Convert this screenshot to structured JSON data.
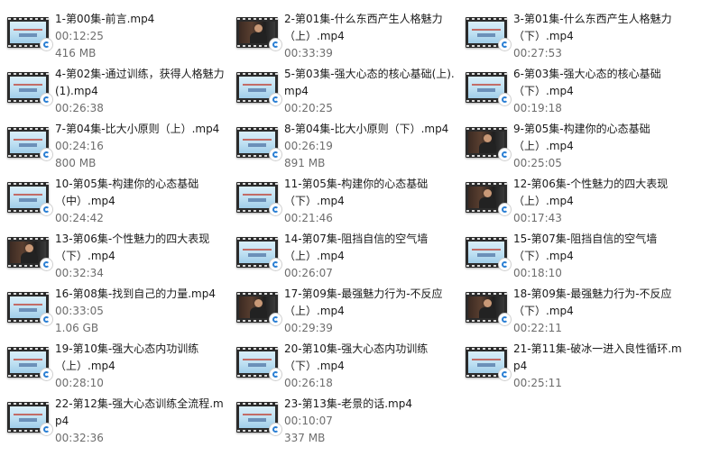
{
  "files": [
    {
      "name": "1-第00集-前言.mp4",
      "duration": "00:12:25",
      "size": "416 MB",
      "thumb": "slide"
    },
    {
      "name": "2-第01集-什么东西产生人格魅力（上）.mp4",
      "duration": "00:33:39",
      "size": "",
      "thumb": "person"
    },
    {
      "name": "3-第01集-什么东西产生人格魅力（下）.mp4",
      "duration": "00:27:53",
      "size": "",
      "thumb": "slide"
    },
    {
      "name": "4-第02集-通过训练，获得人格魅力(1).mp4",
      "duration": "00:26:38",
      "size": "",
      "thumb": "slide"
    },
    {
      "name": "5-第03集-强大心态的核心基础(上).mp4",
      "duration": "00:20:25",
      "size": "",
      "thumb": "slide"
    },
    {
      "name": "6-第03集-强大心态的核心基础（下）.mp4",
      "duration": "00:19:18",
      "size": "",
      "thumb": "slide"
    },
    {
      "name": "7-第04集-比大小原则（上）.mp4",
      "duration": "00:24:16",
      "size": "800 MB",
      "thumb": "slide"
    },
    {
      "name": "8-第04集-比大小原则（下）.mp4",
      "duration": "00:26:19",
      "size": "891 MB",
      "thumb": "slide"
    },
    {
      "name": "9-第05集-构建你的心态基础（上）.mp4",
      "duration": "00:25:05",
      "size": "",
      "thumb": "person"
    },
    {
      "name": "10-第05集-构建你的心态基础（中）.mp4",
      "duration": "00:24:42",
      "size": "",
      "thumb": "slide"
    },
    {
      "name": "11-第05集-构建你的心态基础（下）.mp4",
      "duration": "00:21:46",
      "size": "",
      "thumb": "slide"
    },
    {
      "name": "12-第06集-个性魅力的四大表现（上）.mp4",
      "duration": "00:17:43",
      "size": "",
      "thumb": "person"
    },
    {
      "name": "13-第06集-个性魅力的四大表现（下）.mp4",
      "duration": "00:32:34",
      "size": "",
      "thumb": "person"
    },
    {
      "name": "14-第07集-阻挡自信的空气墙（上）.mp4",
      "duration": "00:26:07",
      "size": "",
      "thumb": "slide"
    },
    {
      "name": "15-第07集-阻挡自信的空气墙（下）.mp4",
      "duration": "00:18:10",
      "size": "",
      "thumb": "slide"
    },
    {
      "name": "16-第08集-找到自己的力量.mp4",
      "duration": "00:33:05",
      "size": "1.06 GB",
      "thumb": "slide"
    },
    {
      "name": "17-第09集-最强魅力行为-不反应（上）.mp4",
      "duration": "00:29:39",
      "size": "",
      "thumb": "person"
    },
    {
      "name": "18-第09集-最强魅力行为-不反应（下）.mp4",
      "duration": "00:22:11",
      "size": "",
      "thumb": "person"
    },
    {
      "name": "19-第10集-强大心态内功训练（上）.mp4",
      "duration": "00:28:10",
      "size": "",
      "thumb": "slide"
    },
    {
      "name": "20-第10集-强大心态内功训练（下）.mp4",
      "duration": "00:26:18",
      "size": "",
      "thumb": "slide"
    },
    {
      "name": "21-第11集-破冰一进入良性循环.mp4",
      "duration": "00:25:11",
      "size": "",
      "thumb": "slide"
    },
    {
      "name": "22-第12集-强大心态训练全流程.mp4",
      "duration": "00:32:36",
      "size": "",
      "thumb": "slide"
    },
    {
      "name": "23-第13集-老景的话.mp4",
      "duration": "00:10:07",
      "size": "337 MB",
      "thumb": "slide"
    }
  ]
}
